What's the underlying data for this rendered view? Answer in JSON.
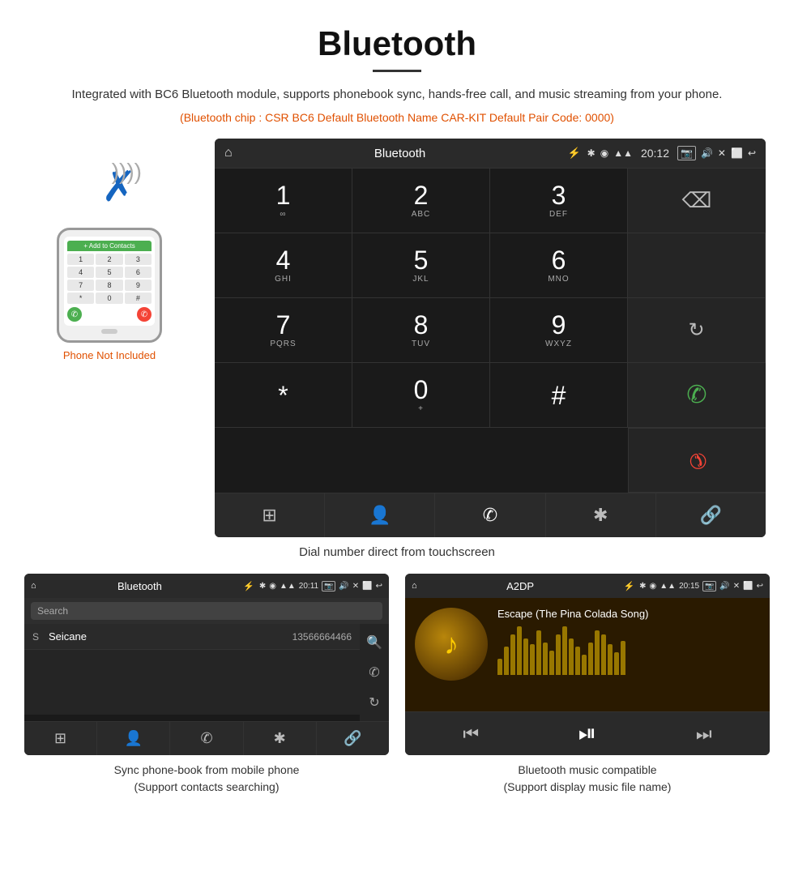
{
  "page": {
    "title": "Bluetooth",
    "subtitle": "Integrated with BC6 Bluetooth module, supports phonebook sync, hands-free call, and music streaming from your phone.",
    "specs": "(Bluetooth chip : CSR BC6    Default Bluetooth Name CAR-KIT    Default Pair Code: 0000)",
    "dial_caption": "Dial number direct from touchscreen",
    "phone_not_included": "Phone Not Included",
    "phonebook_caption": "Sync phone-book from mobile phone\n(Support contacts searching)",
    "music_caption": "Bluetooth music compatible\n(Support display music file name)"
  },
  "car_screen": {
    "status_title": "Bluetooth",
    "time": "20:12",
    "usb_icon": "⚡",
    "bt_icon": "✱",
    "loc_icon": "◉",
    "signal_icon": "▲",
    "dialpad": [
      {
        "num": "1",
        "sub": "∞",
        "row": 0,
        "col": 0
      },
      {
        "num": "2",
        "sub": "ABC",
        "row": 0,
        "col": 1
      },
      {
        "num": "3",
        "sub": "DEF",
        "row": 0,
        "col": 2
      },
      {
        "num": "4",
        "sub": "GHI",
        "row": 1,
        "col": 0
      },
      {
        "num": "5",
        "sub": "JKL",
        "row": 1,
        "col": 1
      },
      {
        "num": "6",
        "sub": "MNO",
        "row": 1,
        "col": 2
      },
      {
        "num": "7",
        "sub": "PQRS",
        "row": 2,
        "col": 0
      },
      {
        "num": "8",
        "sub": "TUV",
        "row": 2,
        "col": 1
      },
      {
        "num": "9",
        "sub": "WXYZ",
        "row": 2,
        "col": 2
      },
      {
        "num": "*",
        "sub": "",
        "row": 3,
        "col": 0
      },
      {
        "num": "0",
        "sub": "+",
        "row": 3,
        "col": 1
      },
      {
        "num": "#",
        "sub": "",
        "row": 3,
        "col": 2
      }
    ]
  },
  "phonebook_screen": {
    "title": "Bluetooth",
    "time": "20:11",
    "search_placeholder": "Search",
    "contact_letter": "S",
    "contact_name": "Seicane",
    "contact_number": "13566664466"
  },
  "music_screen": {
    "title": "A2DP",
    "time": "20:15",
    "song_title": "Escape (The Pina Colada Song)",
    "eq_bars": [
      20,
      35,
      50,
      60,
      45,
      38,
      55,
      40,
      30,
      50,
      60,
      45,
      35,
      25,
      40,
      55,
      50,
      38,
      28,
      42
    ]
  },
  "icons": {
    "home": "⌂",
    "back": "↩",
    "phone": "✆",
    "bluetooth": "✱",
    "grid": "⊞",
    "person": "👤",
    "link": "🔗",
    "refresh": "↻",
    "search": "🔍",
    "prev": "⏮",
    "play_pause": "⏯",
    "next": "⏭",
    "music_note": "♪"
  }
}
